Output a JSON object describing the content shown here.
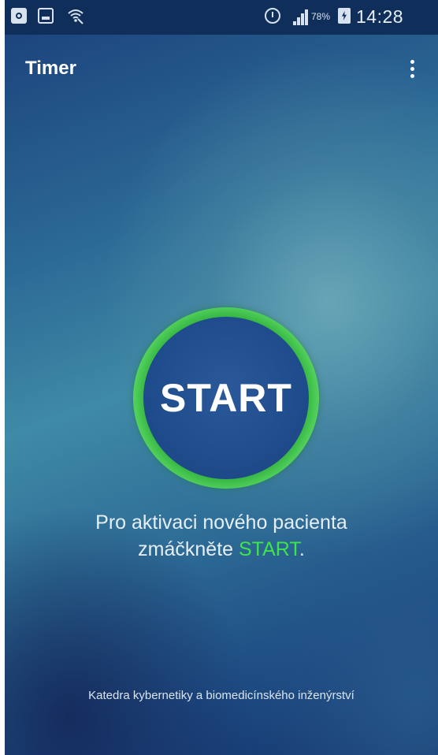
{
  "status_bar": {
    "battery_percent": "78%",
    "time": "14:28",
    "icons": [
      "notification-icon",
      "image-icon",
      "wifi-icon",
      "alarm-icon",
      "signal-icon",
      "battery-charging-icon"
    ]
  },
  "app_bar": {
    "title": "Timer",
    "menu_icon": "more-vert-icon"
  },
  "main": {
    "start_button_label": "START",
    "instruction_line1": "Pro aktivaci nového pacienta",
    "instruction_line2_prefix": "zmáčkněte ",
    "instruction_line2_highlight": "START",
    "instruction_line2_suffix": ".",
    "highlight_color": "#3fe34b",
    "ring_color": "#2fae3e",
    "button_color": "#1f4c8c"
  },
  "footer": {
    "text": "Katedra kybernetiky a biomedicínského inženýrství"
  }
}
